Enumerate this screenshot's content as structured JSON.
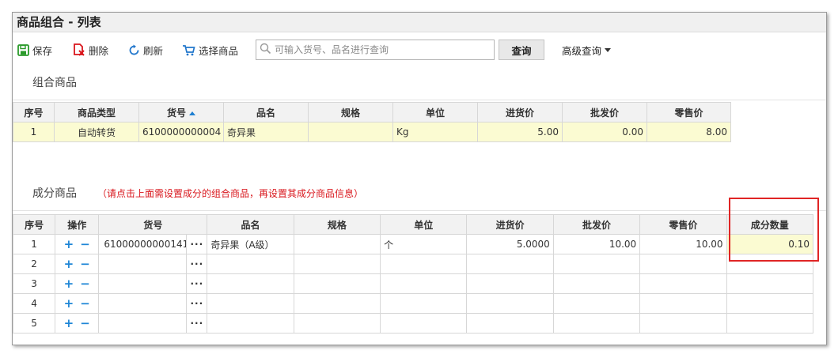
{
  "window": {
    "title": "商品组合 - 列表"
  },
  "toolbar": {
    "save_label": "保存",
    "delete_label": "删除",
    "refresh_label": "刷新",
    "select_label": "选择商品",
    "search_placeholder": "可输入货号、品名进行查询",
    "query_label": "查询",
    "advanced_label": "高级查询"
  },
  "combo_section": {
    "title": "组合商品",
    "columns": [
      "序号",
      "商品类型",
      "货号",
      "品名",
      "规格",
      "单位",
      "进货价",
      "批发价",
      "零售价"
    ],
    "rows": [
      {
        "no": "1",
        "type": "自动转货",
        "code": "6100000000004",
        "name": "奇异果",
        "spec": "",
        "unit": "Kg",
        "purchase": "5.00",
        "wholesale": "0.00",
        "retail": "8.00"
      }
    ]
  },
  "component_section": {
    "title": "成分商品",
    "hint": "（请点击上面需设置成分的组合商品，再设置其成分商品信息）",
    "columns": [
      "序号",
      "操作",
      "货号",
      "品名",
      "规格",
      "单位",
      "进货价",
      "批发价",
      "零售价",
      "成分数量"
    ],
    "rows": [
      {
        "no": "1",
        "code": "61000000000141",
        "name": "奇异果（A级）",
        "spec": "",
        "unit": "个",
        "purchase": "5.0000",
        "wholesale": "10.00",
        "retail": "10.00",
        "qty": "0.10"
      },
      {
        "no": "2",
        "code": "",
        "name": "",
        "spec": "",
        "unit": "",
        "purchase": "",
        "wholesale": "",
        "retail": "",
        "qty": ""
      },
      {
        "no": "3",
        "code": "",
        "name": "",
        "spec": "",
        "unit": "",
        "purchase": "",
        "wholesale": "",
        "retail": "",
        "qty": ""
      },
      {
        "no": "4",
        "code": "",
        "name": "",
        "spec": "",
        "unit": "",
        "purchase": "",
        "wholesale": "",
        "retail": "",
        "qty": ""
      },
      {
        "no": "5",
        "code": "",
        "name": "",
        "spec": "",
        "unit": "",
        "purchase": "",
        "wholesale": "",
        "retail": "",
        "qty": ""
      }
    ],
    "plus_symbol": "+",
    "minus_symbol": "−",
    "dots_symbol": "···"
  },
  "colors": {
    "save_icon": "#2a9a2a",
    "delete_icon": "#d9161c",
    "refresh_icon": "#2277cc",
    "select_icon": "#2277cc",
    "highlight_row": "#fbfbd2",
    "hint_text": "#d9161c",
    "annotation_box": "#e02525"
  },
  "icons": {
    "save": "floppy-disk-icon",
    "delete": "delete-document-icon",
    "refresh": "refresh-icon",
    "select": "cart-icon",
    "search": "magnifier-icon",
    "advanced": "caret-down-icon",
    "sort": "sort-ascending-icon",
    "add_row": "plus-icon",
    "remove_row": "minus-icon",
    "browse": "ellipsis-icon"
  }
}
